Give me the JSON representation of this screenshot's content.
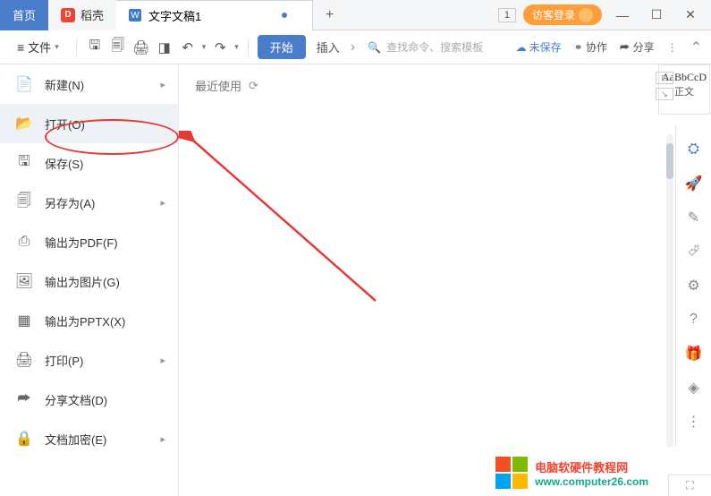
{
  "tabs": {
    "home": "首页",
    "docker": "稻壳",
    "doc": "文字文稿1",
    "add": "+"
  },
  "titlebar": {
    "pagenum": "1",
    "login": "访客登录"
  },
  "toolbar": {
    "file": "文件",
    "start": "开始",
    "insert": "插入",
    "search_placeholder": "查找命令、搜索模板",
    "unsaved": "未保存",
    "collab": "协作",
    "share": "分享"
  },
  "file_menu": [
    {
      "label": "新建(N)",
      "has_arrow": true
    },
    {
      "label": "打开(O)",
      "has_arrow": false
    },
    {
      "label": "保存(S)",
      "has_arrow": false
    },
    {
      "label": "另存为(A)",
      "has_arrow": true
    },
    {
      "label": "输出为PDF(F)",
      "has_arrow": false
    },
    {
      "label": "输出为图片(G)",
      "has_arrow": false
    },
    {
      "label": "输出为PPTX(X)",
      "has_arrow": false
    },
    {
      "label": "打印(P)",
      "has_arrow": true
    },
    {
      "label": "分享文档(D)",
      "has_arrow": false
    },
    {
      "label": "文档加密(E)",
      "has_arrow": true
    }
  ],
  "content": {
    "recent": "最近使用"
  },
  "style": {
    "sample": "AaBbCcD",
    "name": "正文"
  },
  "watermark": {
    "cn": "电脑软硬件教程网",
    "url": "www.computer26.com"
  }
}
